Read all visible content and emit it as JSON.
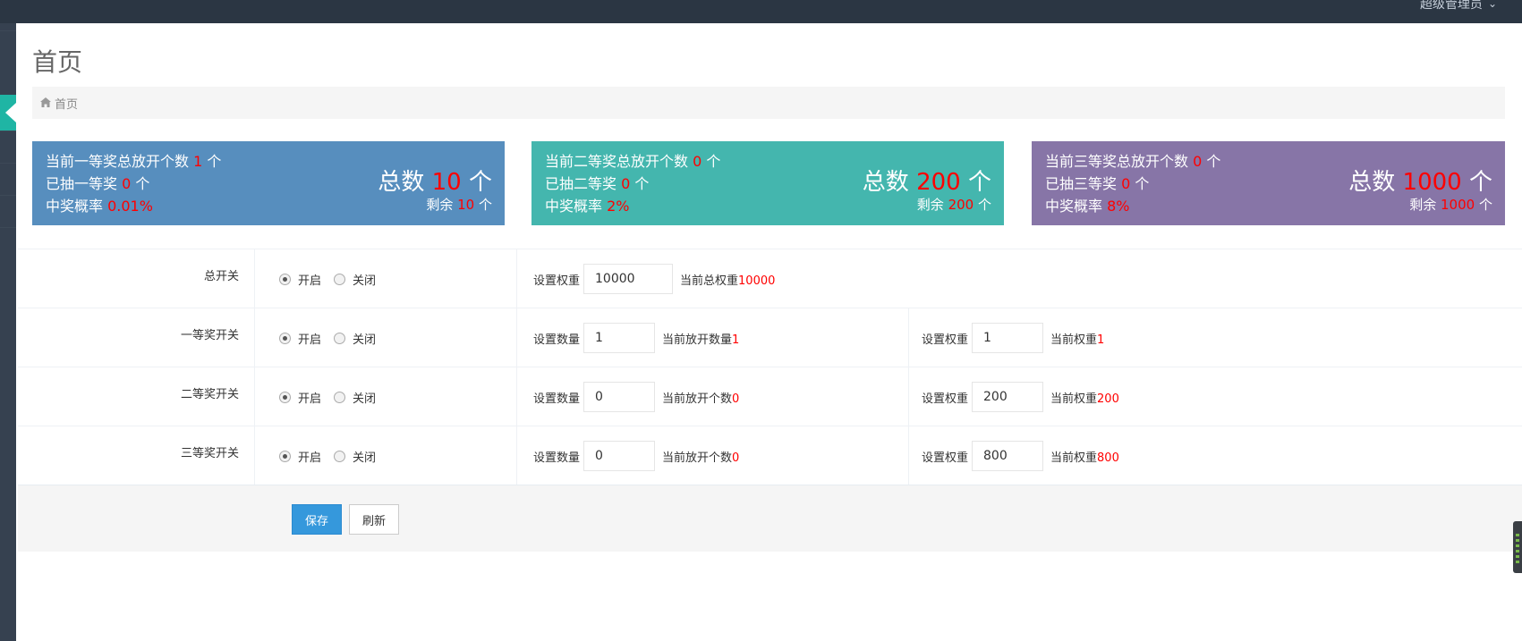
{
  "header": {
    "user_label": "超级管理员",
    "chevron": "chevron-down-icon"
  },
  "page": {
    "title": "首页"
  },
  "breadcrumb": {
    "home_label": "首页",
    "icon": "home-icon"
  },
  "stats": [
    {
      "line1_prefix": "当前一等奖总放开个数",
      "line1_value": "1",
      "line1_suffix": "个",
      "line2_prefix": "已抽一等奖",
      "line2_value": "0",
      "line2_suffix": "个",
      "line3_prefix": "中奖概率",
      "line3_value": "0.01%",
      "total_prefix": "总数",
      "total_value": "10",
      "total_suffix": "个",
      "remain_prefix": "剩余",
      "remain_value": "10",
      "remain_suffix": "个",
      "color": "#578ebe"
    },
    {
      "line1_prefix": "当前二等奖总放开个数",
      "line1_value": "0",
      "line1_suffix": "个",
      "line2_prefix": "已抽二等奖",
      "line2_value": "0",
      "line2_suffix": "个",
      "line3_prefix": "中奖概率",
      "line3_value": "2%",
      "total_prefix": "总数",
      "total_value": "200",
      "total_suffix": "个",
      "remain_prefix": "剩余",
      "remain_value": "200",
      "remain_suffix": "个",
      "color": "#44b6ae"
    },
    {
      "line1_prefix": "当前三等奖总放开个数",
      "line1_value": "0",
      "line1_suffix": "个",
      "line2_prefix": "已抽三等奖",
      "line2_value": "0",
      "line2_suffix": "个",
      "line3_prefix": "中奖概率",
      "line3_value": "8%",
      "total_prefix": "总数",
      "total_value": "1000",
      "total_suffix": "个",
      "remain_prefix": "剩余",
      "remain_value": "1000",
      "remain_suffix": "个",
      "color": "#8775a7"
    }
  ],
  "form": {
    "rows": [
      {
        "label": "总开关",
        "on_label": "开启",
        "off_label": "关闭",
        "selected": "on",
        "field1_label": "设置权重",
        "field1_value": "10000",
        "field1_note": "当前总权重",
        "field1_note_value": "10000"
      },
      {
        "label": "一等奖开关",
        "on_label": "开启",
        "off_label": "关闭",
        "selected": "on",
        "field1_label": "设置数量",
        "field1_value": "1",
        "field1_note": "当前放开数量",
        "field1_note_value": "1",
        "field2_label": "设置权重",
        "field2_value": "1",
        "field2_note": "当前权重",
        "field2_note_value": "1"
      },
      {
        "label": "二等奖开关",
        "on_label": "开启",
        "off_label": "关闭",
        "selected": "on",
        "field1_label": "设置数量",
        "field1_value": "0",
        "field1_note": "当前放开个数",
        "field1_note_value": "0",
        "field2_label": "设置权重",
        "field2_value": "200",
        "field2_note": "当前权重",
        "field2_note_value": "200"
      },
      {
        "label": "三等奖开关",
        "on_label": "开启",
        "off_label": "关闭",
        "selected": "on",
        "field1_label": "设置数量",
        "field1_value": "0",
        "field1_note": "当前放开个数",
        "field1_note_value": "0",
        "field2_label": "设置权重",
        "field2_value": "800",
        "field2_note": "当前权重",
        "field2_note_value": "800"
      }
    ],
    "save_label": "保存",
    "refresh_label": "刷新"
  },
  "colors": {
    "accent": "#3598dc",
    "highlight": "#ff0000",
    "sidebar": "#364150",
    "topbar": "#2b3643"
  }
}
